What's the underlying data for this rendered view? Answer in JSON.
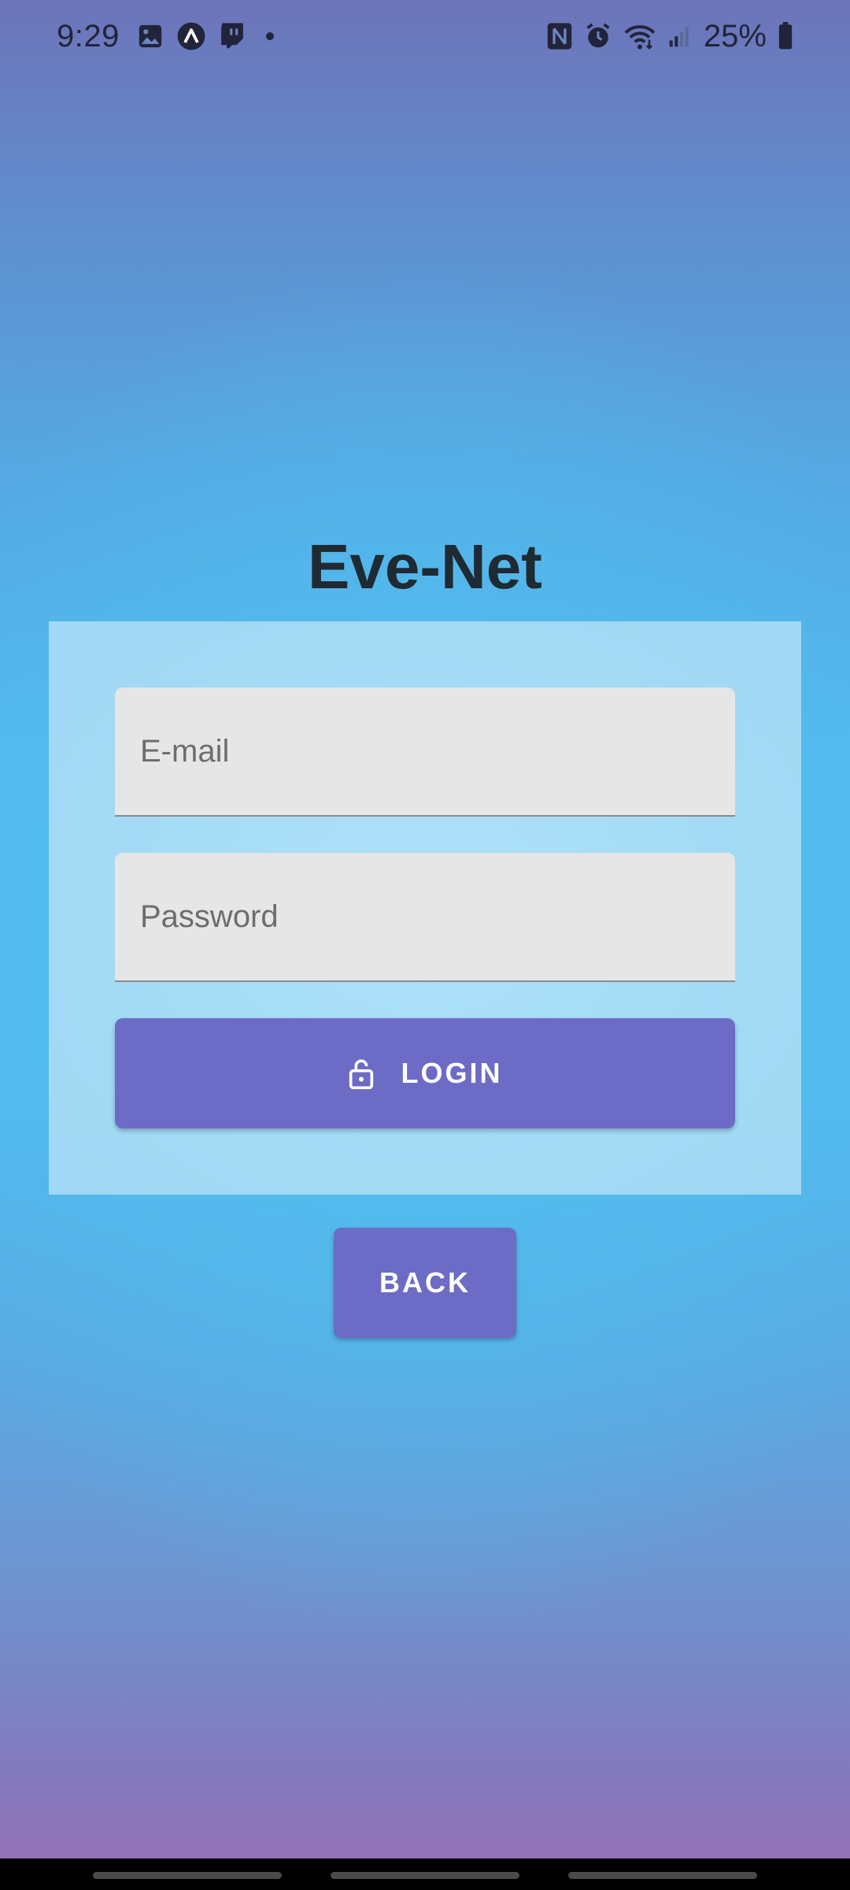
{
  "status_bar": {
    "time": "9:29",
    "battery": "25%",
    "left_icons": [
      "gallery-icon",
      "arrow-up-circle-icon",
      "twitch-icon",
      "notification-dot"
    ],
    "right_icons": [
      "nfc-icon",
      "alarm-icon",
      "wifi-icon",
      "signal-icon",
      "battery-icon"
    ]
  },
  "app": {
    "title": "Eve-Net"
  },
  "login_form": {
    "email_placeholder": "E-mail",
    "email_value": "",
    "password_placeholder": "Password",
    "password_value": "",
    "login_label": "LOGIN",
    "login_icon": "lock-open-icon"
  },
  "back_button": {
    "label": "BACK"
  },
  "colors": {
    "button": "#6c6bc5",
    "field": "#e6e6e6",
    "card": "#aedff7",
    "title": "#1f2a33"
  }
}
